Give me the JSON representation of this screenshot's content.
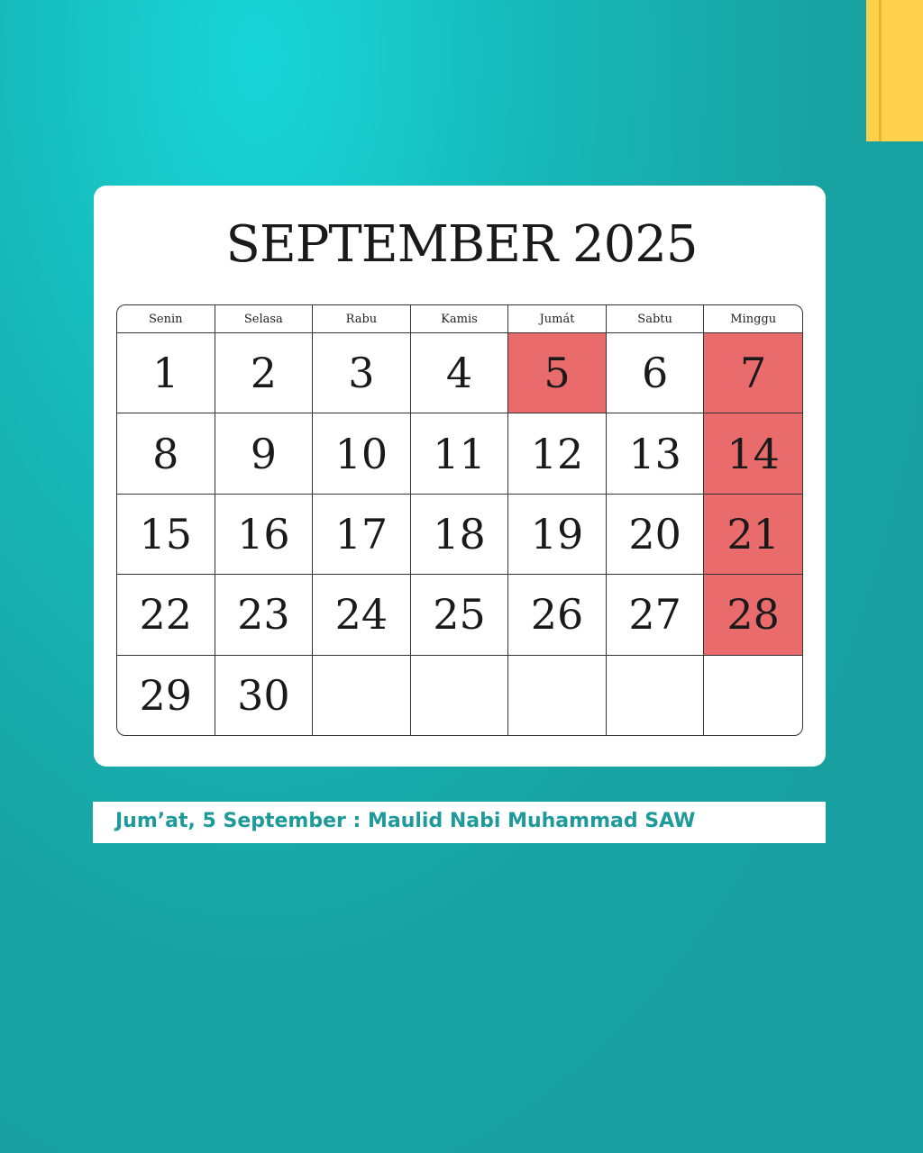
{
  "title": "SEPTEMBER 2025",
  "weekdays": [
    "Senin",
    "Selasa",
    "Rabu",
    "Kamis",
    "Jumát",
    "Sabtu",
    "Minggu"
  ],
  "weeks": [
    [
      "1",
      "2",
      "3",
      "4",
      "5",
      "6",
      "7"
    ],
    [
      "8",
      "9",
      "10",
      "11",
      "12",
      "13",
      "14"
    ],
    [
      "15",
      "16",
      "17",
      "18",
      "19",
      "20",
      "21"
    ],
    [
      "22",
      "23",
      "24",
      "25",
      "26",
      "27",
      "28"
    ],
    [
      "29",
      "30",
      "",
      "",
      "",
      "",
      ""
    ]
  ],
  "highlighted_days": [
    "5",
    "7",
    "14",
    "21",
    "28"
  ],
  "note": "Jum’at, 5 September : Maulid Nabi Muhammad SAW",
  "colors": {
    "background": "#18a2a2",
    "highlight": "#ea6b6b",
    "accent": "#fdd14c",
    "note_text": "#1f9a9a"
  }
}
